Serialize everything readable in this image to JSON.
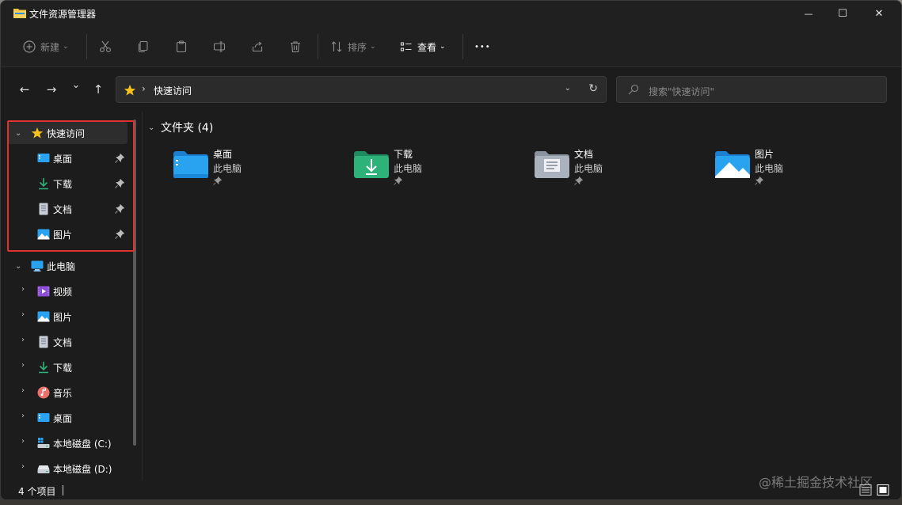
{
  "window": {
    "title": "文件资源管理器",
    "minimize_glyph": "—",
    "maximize_glyph": "☐",
    "close_glyph": "✕"
  },
  "toolbar": {
    "new_label": "新建",
    "sort_label": "排序",
    "view_label": "查看",
    "more_glyph": "•••"
  },
  "nav": {
    "back_glyph": "←",
    "forward_glyph": "→",
    "recent_glyph": "⌄",
    "up_glyph": "↑"
  },
  "address": {
    "separator": "›",
    "location": "快速访问",
    "dropdown_glyph": "⌄",
    "refresh_glyph": "↻"
  },
  "search": {
    "placeholder": "搜索\"快速访问\""
  },
  "sidebar": {
    "quick_access": {
      "label": "快速访问",
      "items": [
        {
          "label": "桌面",
          "icon": "desktop-icon"
        },
        {
          "label": "下载",
          "icon": "download-icon"
        },
        {
          "label": "文档",
          "icon": "document-icon"
        },
        {
          "label": "图片",
          "icon": "pictures-icon"
        }
      ]
    },
    "this_pc": {
      "label": "此电脑",
      "items": [
        {
          "label": "视频",
          "icon": "videos-icon"
        },
        {
          "label": "图片",
          "icon": "pictures-icon"
        },
        {
          "label": "文档",
          "icon": "document-icon"
        },
        {
          "label": "下载",
          "icon": "download-icon"
        },
        {
          "label": "音乐",
          "icon": "music-icon"
        },
        {
          "label": "桌面",
          "icon": "desktop-icon"
        },
        {
          "label": "本地磁盘 (C:)",
          "icon": "drive-c-icon"
        },
        {
          "label": "本地磁盘 (D:)",
          "icon": "drive-icon"
        }
      ]
    }
  },
  "content": {
    "group_title": "文件夹 (4)",
    "folders": [
      {
        "name": "桌面",
        "location": "此电脑",
        "icon": "desktop-folder-icon"
      },
      {
        "name": "下载",
        "location": "此电脑",
        "icon": "downloads-folder-icon"
      },
      {
        "name": "文档",
        "location": "此电脑",
        "icon": "documents-folder-icon"
      },
      {
        "name": "图片",
        "location": "此电脑",
        "icon": "pictures-folder-icon"
      }
    ]
  },
  "status": {
    "item_count": "4 个项目"
  },
  "watermark": "@稀土掘金技术社区",
  "colors": {
    "window_bg": "#1c1c1c",
    "toolbar_bg": "#202020",
    "highlight_border": "#e0322e",
    "accent_blue": "#29a3f0",
    "download_green": "#2db37a"
  }
}
